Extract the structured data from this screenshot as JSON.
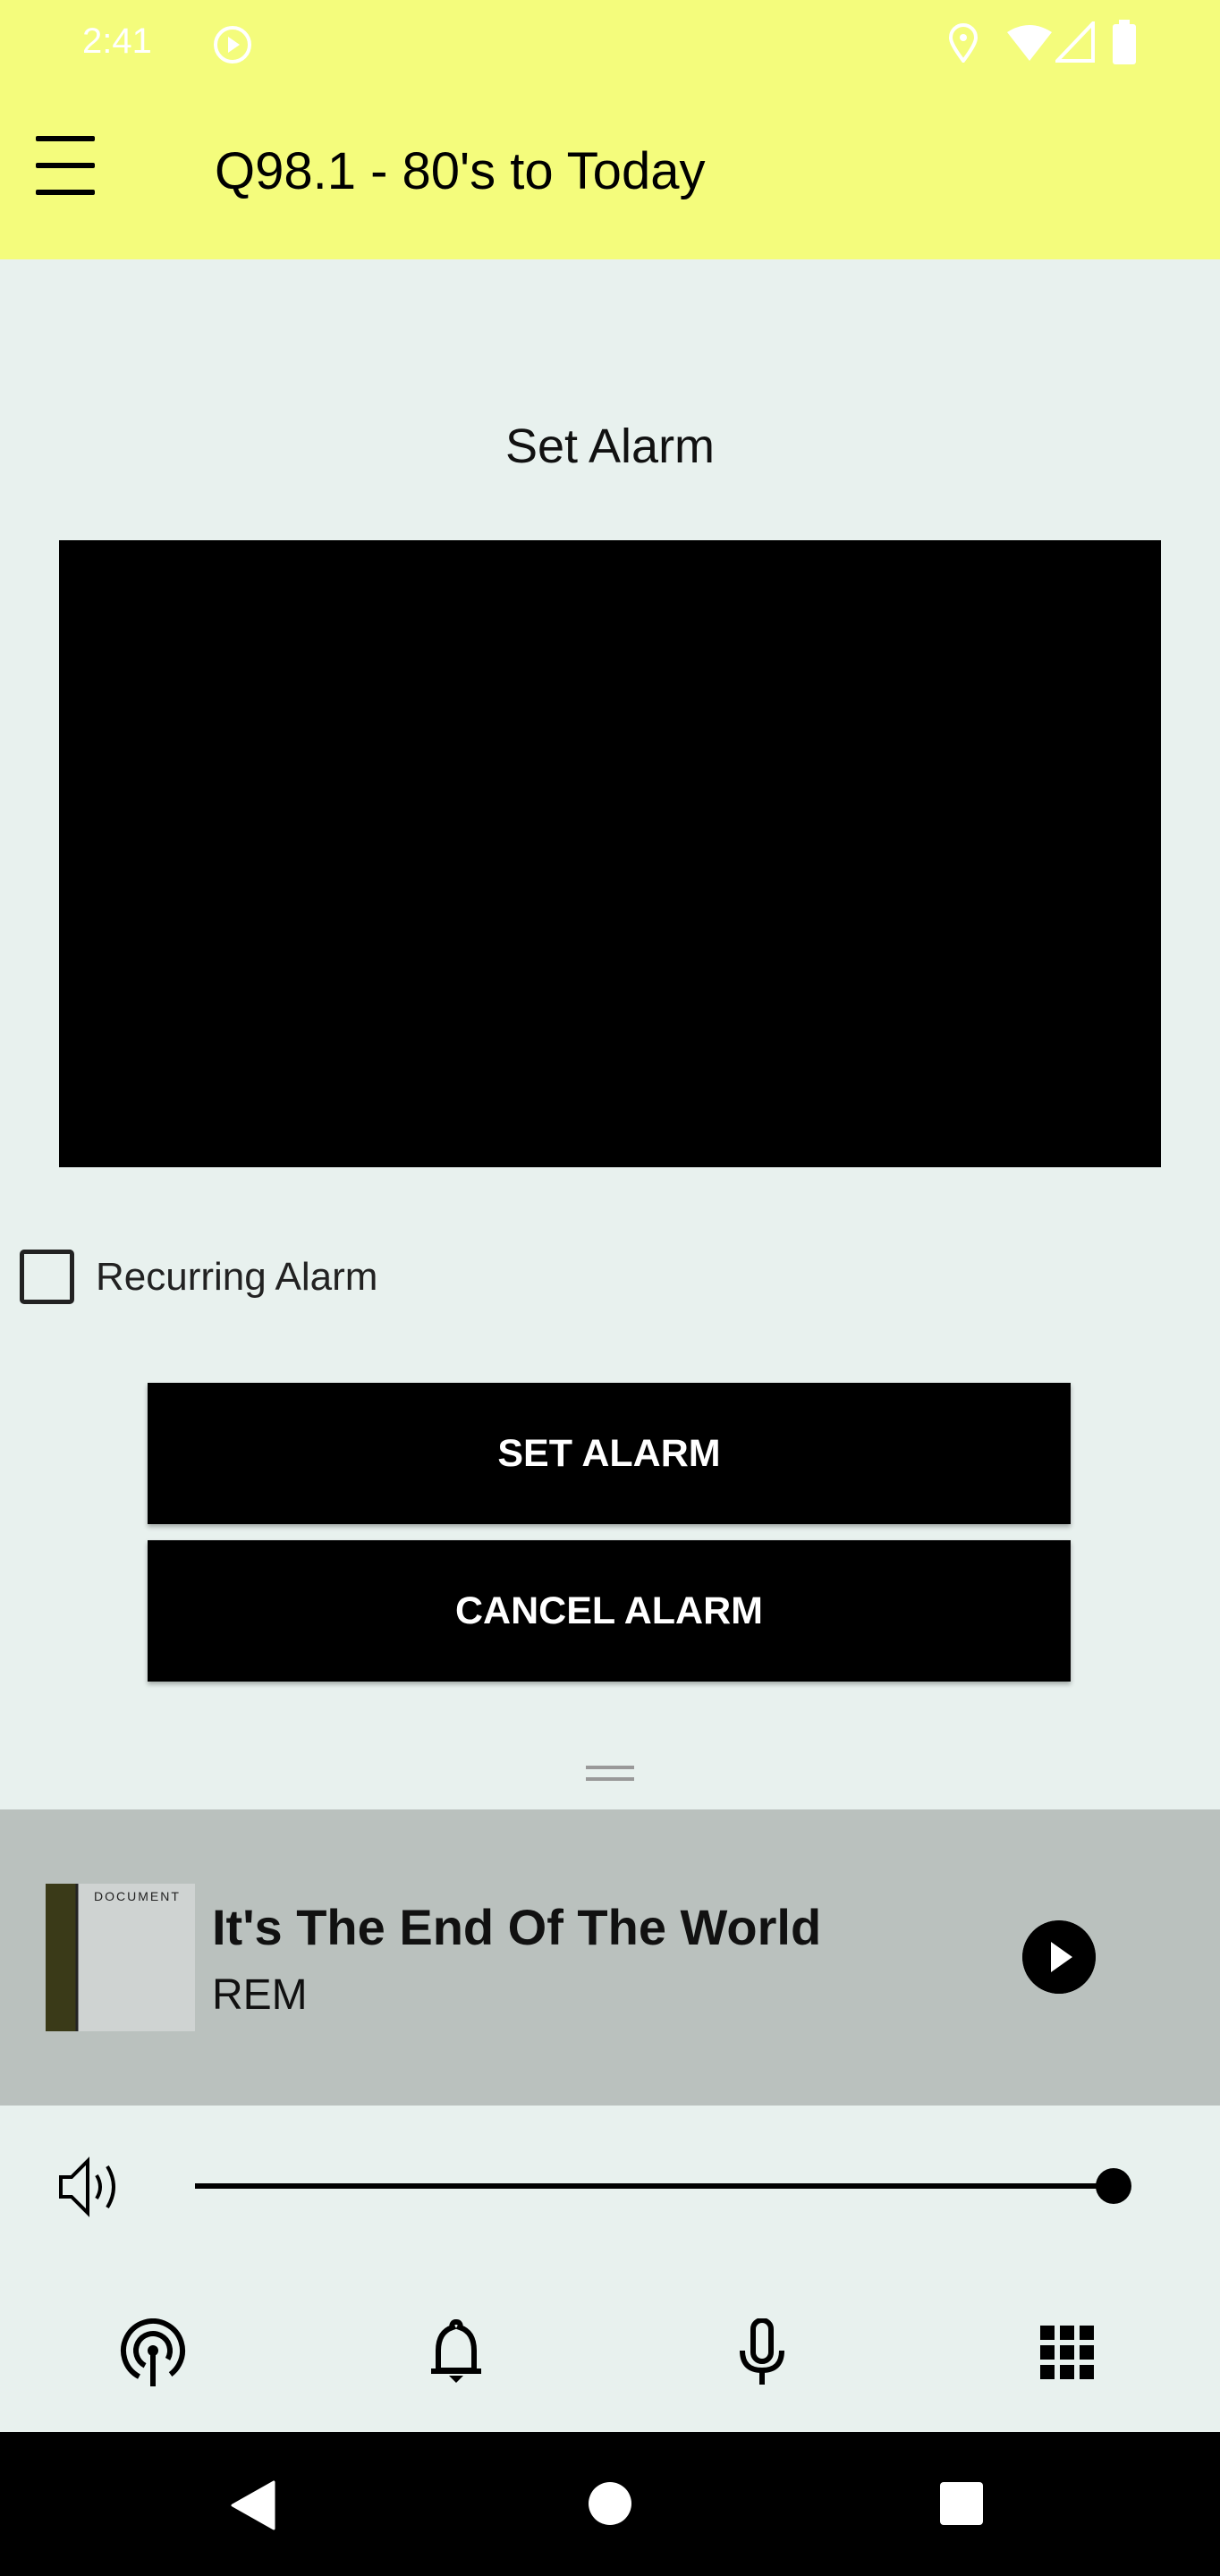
{
  "status_bar": {
    "time": "2:41",
    "icons": [
      "play-circle-icon",
      "location-icon",
      "wifi-icon",
      "signal-icon",
      "battery-icon"
    ]
  },
  "app_bar": {
    "title": "Q98.1 - 80's to Today",
    "menu_icon": "hamburger-menu-icon",
    "background": "#f4fc7c"
  },
  "alarm": {
    "heading": "Set Alarm",
    "recurring_label": "Recurring Alarm",
    "recurring_checked": false,
    "set_label": "SET ALARM",
    "cancel_label": "CANCEL ALARM"
  },
  "now_playing": {
    "song": "It's The End Of The World",
    "artist": "REM",
    "album_art_text": "DOCUMENT",
    "play_icon": "play-icon"
  },
  "volume": {
    "level_percent": 100
  },
  "bottom_nav": [
    "podcast-icon",
    "bell-icon",
    "microphone-icon",
    "grid-icon"
  ],
  "system_nav": [
    "back-icon",
    "home-icon",
    "recents-icon"
  ]
}
